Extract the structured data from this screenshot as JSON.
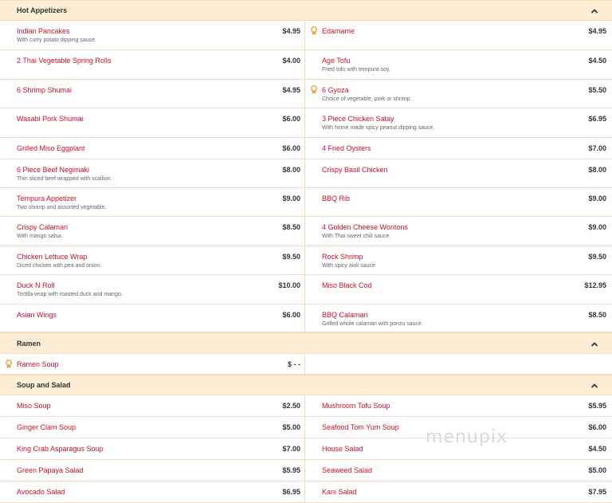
{
  "colors": {
    "accent": "#c8102e",
    "header_bg": "#fdedd4",
    "badge": "#e8a33a"
  },
  "sections": [
    {
      "title": "Hot Appetizers",
      "left": [
        {
          "name": "Indian Pancakes",
          "desc": "With curry potato dipping sauce.",
          "price": "$4.95"
        },
        {
          "name": "2 Thai Vegetable Spring Rolls",
          "desc": "",
          "price": "$4.00"
        },
        {
          "name": "6 Shrimp Shumai",
          "desc": "",
          "price": "$4.95"
        },
        {
          "name": "Wasabi Pork Shumai",
          "desc": "",
          "price": "$6.00"
        },
        {
          "name": "Grilled Miso Eggplant",
          "desc": "",
          "price": "$6.00"
        },
        {
          "name": "6 Piece Beef Negimaki",
          "desc": "Thin sliced beef wrapped with scallion.",
          "price": "$8.00"
        },
        {
          "name": "Tempura Appetizer",
          "desc": "Two shrimp and assorted vegetable.",
          "price": "$9.00"
        },
        {
          "name": "Crispy Calamari",
          "desc": "With mango salsa.",
          "price": "$8.50"
        },
        {
          "name": "Chicken Lettuce Wrap",
          "desc": "Diced chicken with pea and onion.",
          "price": "$9.50"
        },
        {
          "name": "Duck N Roll",
          "desc": "Tortilla wrap with roasted duck and mango.",
          "price": "$10.00"
        },
        {
          "name": "Asian Wings",
          "desc": "",
          "price": "$6.00"
        }
      ],
      "right": [
        {
          "name": "Edamame",
          "desc": "",
          "price": "$4.95",
          "badge": "award-icon"
        },
        {
          "name": "Age Tofu",
          "desc": "Fried tofu with tempura soy.",
          "price": "$4.50"
        },
        {
          "name": "6 Gyoza",
          "desc": "Choice of vegetable, pork or shrimp.",
          "price": "$5.50",
          "badge": "award-icon"
        },
        {
          "name": "3 Piece Chicken Satay",
          "desc": "With home made spicy peanut dipping sauce.",
          "price": "$6.95"
        },
        {
          "name": "4 Fried Oysters",
          "desc": "",
          "price": "$7.00"
        },
        {
          "name": "Crispy Basil Chicken",
          "desc": "",
          "price": "$8.00"
        },
        {
          "name": "BBQ Rib",
          "desc": "",
          "price": "$9.00"
        },
        {
          "name": "4 Golden Cheese Wontons",
          "desc": "With Thai sweet chili sauce.",
          "price": "$9.00"
        },
        {
          "name": "Rock Shrimp",
          "desc": "With spicy aioli sauce.",
          "price": "$9.50"
        },
        {
          "name": "Miso Black Cod",
          "desc": "",
          "price": "$12.95"
        },
        {
          "name": "BBQ Calamari",
          "desc": "Grilled whole calamari with ponzu sauce.",
          "price": "$8.50"
        }
      ]
    },
    {
      "title": "Ramen",
      "left": [
        {
          "name": "Ramen Soup",
          "desc": "",
          "price": "$ - -",
          "badge": "award-icon"
        }
      ],
      "right": []
    },
    {
      "title": "Soup and Salad",
      "left": [
        {
          "name": "Miso Soup",
          "desc": "",
          "price": "$2.50"
        },
        {
          "name": "Ginger Clam Soup",
          "desc": "",
          "price": "$5.00"
        },
        {
          "name": "King Crab Asparagus Soup",
          "desc": "",
          "price": "$7.00"
        },
        {
          "name": "Green Papaya Salad",
          "desc": "",
          "price": "$5.95"
        },
        {
          "name": "Avocado Salad",
          "desc": "",
          "price": "$6.95"
        }
      ],
      "right": [
        {
          "name": "Mushroom Tofu Soup",
          "desc": "",
          "price": "$5.95"
        },
        {
          "name": "Seafood Tom Yum Soup",
          "desc": "",
          "price": "$6.00"
        },
        {
          "name": "House Salad",
          "desc": "",
          "price": "$4.50"
        },
        {
          "name": "Seaweed Salad",
          "desc": "",
          "price": "$5.00"
        },
        {
          "name": "Kani Salad",
          "desc": "",
          "price": "$7.95"
        }
      ]
    }
  ],
  "watermark": "menupix"
}
